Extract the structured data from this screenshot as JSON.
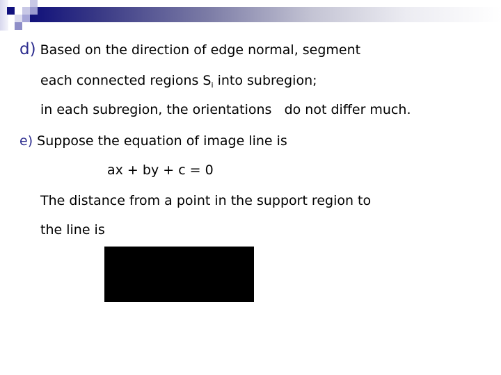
{
  "slide": {
    "items": [
      {
        "label": "d)",
        "text": "Based on the direction of edge normal, segment",
        "continuation": [
          {
            "before": "each connected regions S",
            "subscript": "i",
            "after": " into subregion;"
          },
          {
            "text": "in each subregion, the orientations   do not differ much."
          }
        ]
      },
      {
        "label": "e)",
        "text": "Suppose the equation of image line is",
        "equation": "ax + by + c = 0",
        "continuation": [
          {
            "text": "The distance from a point in the support region to"
          },
          {
            "text": "the line is"
          }
        ]
      }
    ],
    "formula_image": {
      "description": "distance formula image (rendered as black box)"
    }
  },
  "colors": {
    "label": "#2e2e8f",
    "text": "#000000",
    "header_dark": "#10107a",
    "background": "#ffffff"
  }
}
